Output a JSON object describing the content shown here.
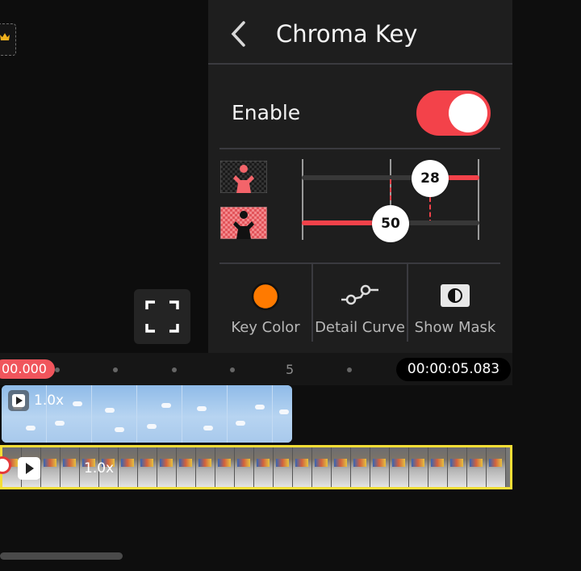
{
  "panel": {
    "title": "Chroma Key",
    "back_icon": "chevron-left-icon",
    "enable_label": "Enable",
    "enable_on": true
  },
  "sliders": {
    "top": {
      "value": "28",
      "icon": "person-silhouette-checker-icon"
    },
    "bottom": {
      "value": "50",
      "icon": "person-silhouette-red-icon"
    }
  },
  "tools": [
    {
      "label": "Key Color",
      "icon": "color-circle-icon",
      "color": "#ff7a00"
    },
    {
      "label": "Detail Curve",
      "icon": "curve-nodes-icon"
    },
    {
      "label": "Show Mask",
      "icon": "mask-icon"
    }
  ],
  "timeline": {
    "current_time": "00.000",
    "total_time": "00:00:05.083",
    "marker_label": "5"
  },
  "tracks": {
    "overlay_speed": "1.0x",
    "main_speed": "1.0x"
  },
  "colors": {
    "accent": "#f3424a",
    "selection": "#f5de36",
    "panel_bg": "#1e1e1e"
  }
}
